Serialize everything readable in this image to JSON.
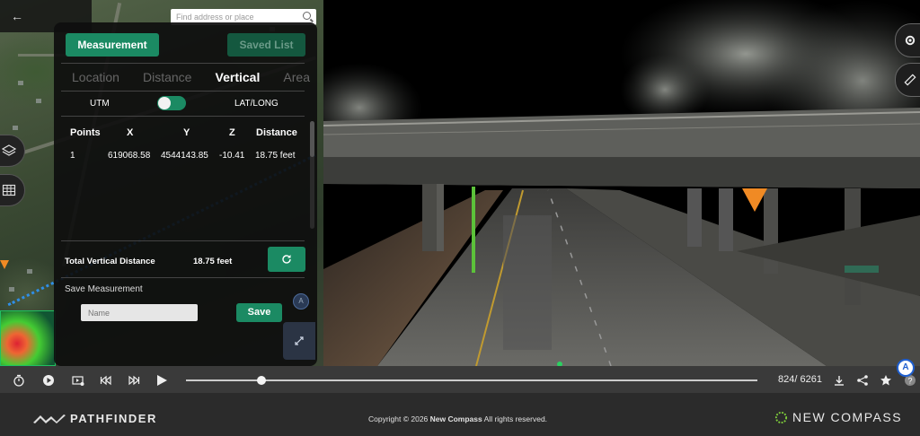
{
  "map": {
    "back_icon": "arrow-left-icon",
    "search_placeholder": "Find address or place",
    "layers_icon": "layers-icon",
    "table_icon": "table-grid-icon"
  },
  "panel": {
    "measurement_label": "Measurement",
    "saved_list_label": "Saved List",
    "tabs": [
      {
        "label": "Location",
        "active": false
      },
      {
        "label": "Distance",
        "active": false
      },
      {
        "label": "Vertical",
        "active": true
      },
      {
        "label": "Area",
        "active": false
      }
    ],
    "toggle_left": "UTM",
    "toggle_right": "LAT/LONG",
    "table": {
      "headers": [
        "Points",
        "X",
        "Y",
        "Z",
        "Distance"
      ],
      "rows": [
        [
          "1",
          "619068.58",
          "4544143.85",
          "-10.41",
          "18.75 feet"
        ]
      ]
    },
    "total_label": "Total Vertical Distance",
    "total_value": "18.75 feet",
    "save_title": "Save Measurement",
    "name_placeholder": "Name",
    "save_label": "Save",
    "compass_letter": "A"
  },
  "player": {
    "frame_count": "824/ 6261",
    "progress": 0.1317,
    "compass_letter": "A"
  },
  "footer": {
    "brand": "PATHFINDER",
    "copyright_prefix": "Copyright © 2026 ",
    "copyright_company": "New Compass",
    "copyright_suffix": " All rights reserved.",
    "company_logo": "NEW COMPASS"
  },
  "colors": {
    "accent_green": "#1b8a63",
    "marker_orange": "#f08a24",
    "measure_line": "#5cc23a",
    "player_bar": "#3a3a3a",
    "footer": "#2b2b2b"
  }
}
